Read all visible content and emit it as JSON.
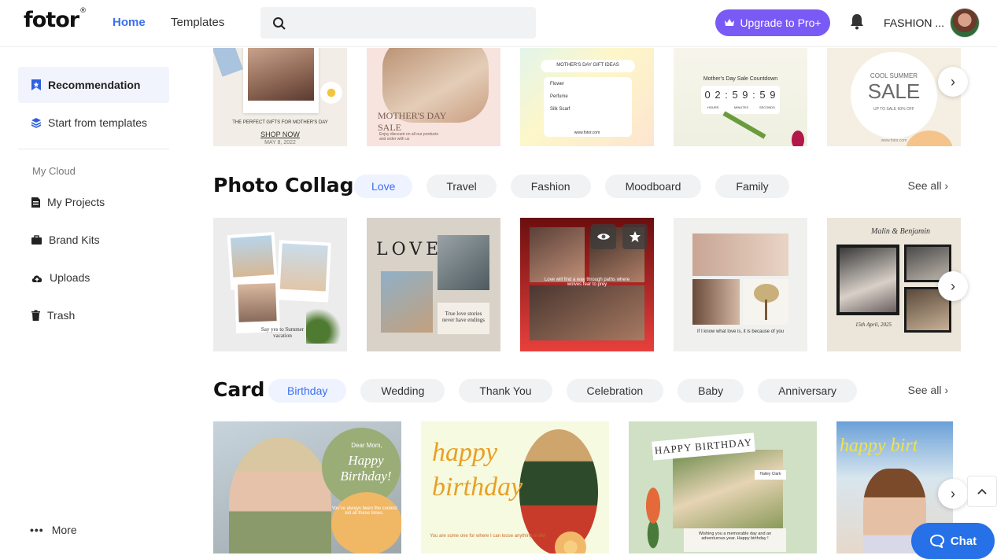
{
  "header": {
    "logo": "fotor",
    "logo_mark": "®",
    "nav_home": "Home",
    "nav_templates": "Templates",
    "search_placeholder": "",
    "upgrade_label": "Upgrade to Pro+",
    "username": "FASHION ...",
    "colors": {
      "accent": "#3c6ff0",
      "upgrade": "#7a5af5"
    }
  },
  "sidebar": {
    "recommendation": "Recommendation",
    "start_from_templates": "Start from templates",
    "cloud_label": "My Cloud",
    "my_projects": "My Projects",
    "brand_kits": "Brand Kits",
    "uploads": "Uploads",
    "trash": "Trash",
    "more": "More"
  },
  "top_row": {
    "t1": {
      "line1": "THE PERFECT GIFTS FOR MOTHER'S DAY",
      "cta": "SHOP NOW",
      "date": "MAY 8, 2022"
    },
    "t2": {
      "title": "MOTHER'S DAY SALE",
      "body": "Enjoy discount on all our products and order with us"
    },
    "t3": {
      "header": "MOTHER'S DAY GIFT IDEAS",
      "items": [
        "Flower",
        "Perfume",
        "Silk Scarf"
      ],
      "url": "www.fotor.com"
    },
    "t4": {
      "title": "Mother's Day Sale Countdown",
      "digits": "0 2 : 5 9 : 5 9",
      "units": [
        "HOURS",
        "MINUTES",
        "SECONDS"
      ]
    },
    "t5": {
      "line1": "COOL SUMMER",
      "title": "SALE",
      "sub": "UP TO SALE 60% OFF",
      "url": "www.fotor.com"
    }
  },
  "photo_collage": {
    "title": "Photo Collage",
    "chips": [
      "Love",
      "Travel",
      "Fashion",
      "Moodboard",
      "Family"
    ],
    "active_chip": "Love",
    "see_all": "See all",
    "t1_caption": "Say yes to Summer vacation",
    "t2_word": "LOVE",
    "t2_note": "True love stories never have endings",
    "t3_caption": "Love will find a way through paths where wolves fear to prey",
    "t4_caption": "If I know what love is, it is because of you",
    "t5_names": "Malin & Benjamin",
    "t5_date": "15th April, 2025"
  },
  "card": {
    "title": "Card",
    "chips": [
      "Birthday",
      "Wedding",
      "Thank You",
      "Celebration",
      "Baby",
      "Anniversary"
    ],
    "active_chip": "Birthday",
    "see_all": "See all",
    "c1_top": "Dear Mom,",
    "c1_title": "Happy Birthday!",
    "c1_body": "You've always been the coolest kid all these times.",
    "c2_title": "happy birthday",
    "c2_body": "You are some one for where I can loose anything in life!",
    "c3_title": "HAPPY BIRTHDAY",
    "c3_tag": "Hailey Clark",
    "c3_body": "Wishing you a memorable day and an adventurous year. Happy birthday !",
    "c4_title": "happy birt"
  },
  "chat_label": "Chat"
}
